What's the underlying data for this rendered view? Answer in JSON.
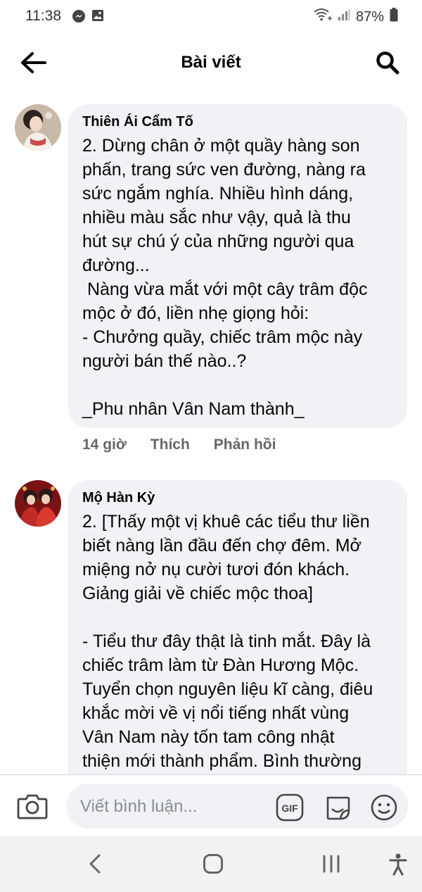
{
  "status_bar": {
    "time": "11:38",
    "battery": "87%"
  },
  "header": {
    "title": "Bài viết"
  },
  "comments": [
    {
      "author": "Thiên Ái Cẩm Tố",
      "lines": [
        "2. Dừng chân ở một quầy hàng son",
        "phấn, trang sức ven đường, nàng ra",
        "sức ngắm nghía. Nhiều hình dáng,",
        "nhiều màu sắc như vậy, quả là thu",
        "hút sự chú ý của những người qua",
        "đường...",
        " Nàng vừa mắt với một cây trâm độc",
        "mộc ở đó, liền nhẹ giọng hỏi:",
        "- Chưởng quầy, chiếc trâm mộc này",
        "người bán thế nào..?",
        "",
        "_Phu nhân Vân Nam thành_"
      ],
      "time": "14 giờ",
      "like_label": "Thích",
      "reply_label": "Phản hồi"
    },
    {
      "author": "Mộ Hàn Kỳ",
      "lines": [
        "2. [Thấy một vị khuê các tiểu thư liền",
        "biết nàng lần đầu đến chợ đêm. Mở",
        "miệng nở nụ cười tươi đón khách.",
        "Giảng giải về chiếc mộc thoa]",
        "",
        "- Tiểu thư đây thật là tinh mắt. Đây là",
        "chiếc trâm làm từ Đàn Hương Mộc.",
        "Tuyển chọn nguyên liệu kĩ càng, điêu",
        "khắc mời về vị nổi tiếng nhất vùng",
        "Vân Nam này tốn tam công nhật",
        "thiện mới thành phẩm. Bình thường"
      ]
    }
  ],
  "composer": {
    "placeholder": "Viết bình luận..."
  },
  "icons": {
    "back": "arrow-left-icon",
    "search": "search-icon",
    "camera": "camera-icon",
    "gif": "gif-icon",
    "sticker": "sticker-icon",
    "emoji": "emoji-icon",
    "nav_back": "chevron-left-icon",
    "nav_home": "home-icon",
    "nav_recent": "recent-apps-icon",
    "nav_accessibility": "accessibility-icon"
  },
  "colors": {
    "bubble": "#f0f2f5",
    "meta_text": "#65676b"
  }
}
